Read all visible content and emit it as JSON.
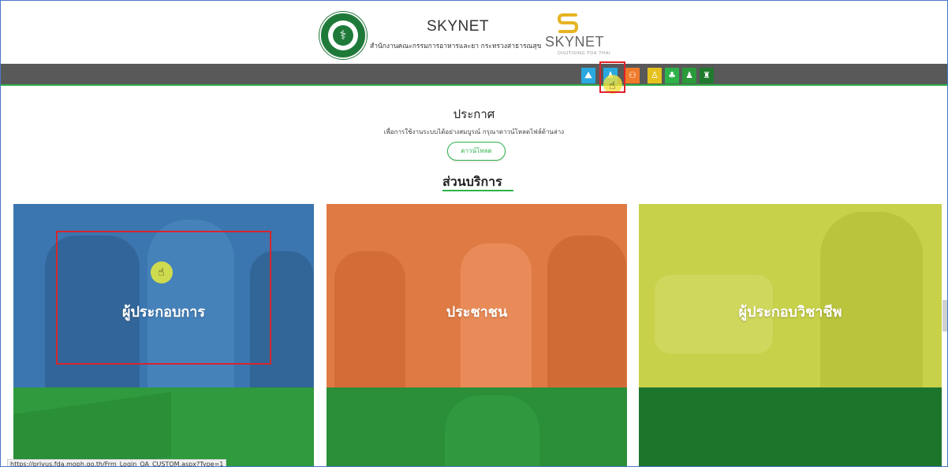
{
  "header": {
    "title": "SKYNET",
    "subtitle": "สำนักงานคณะกรรมการอาหารและยา กระทรวงสาธารณสุข",
    "logo_text": "SKYNET",
    "logo_tagline": "DIGITISING FDA THAI"
  },
  "nav": {
    "icons": [
      {
        "name": "mountain-icon",
        "glyph": "⛰",
        "color": "#29a8e0"
      },
      {
        "name": "person-icon",
        "glyph": "♟",
        "color": "#29a8e0"
      },
      {
        "name": "group-icon",
        "glyph": "⚇",
        "color": "#f07a2a"
      },
      {
        "name": "user-icon",
        "glyph": "♙",
        "color": "#e6c21e"
      },
      {
        "name": "tree-icon",
        "glyph": "♣",
        "color": "#2db34a"
      },
      {
        "name": "doctor-icon",
        "glyph": "♟",
        "color": "#2a9a3a"
      },
      {
        "name": "lab-icon",
        "glyph": "♜",
        "color": "#1f7a2e"
      }
    ]
  },
  "announcement": {
    "title": "ประกาศ",
    "text": "เพื่อการใช้งานระบบได้อย่างสมบูรณ์ กรุณาดาวน์โหลดไฟล์ด้านล่าง",
    "download_label": "ดาวน์โหลด"
  },
  "section": {
    "title": "ส่วนบริการ"
  },
  "tiles": {
    "operator": "ผู้ประกอบการ",
    "citizen": "ประชาชน",
    "professional": "ผู้ประกอบวิชาชีพ"
  },
  "status_url": "https://privus.fda.moph.go.th/Frm_Login_OA_CUSTOM.aspx?Type=1",
  "colors": {
    "accent": "#2db34a",
    "navbar": "#595959",
    "highlight": "#e0202a"
  }
}
